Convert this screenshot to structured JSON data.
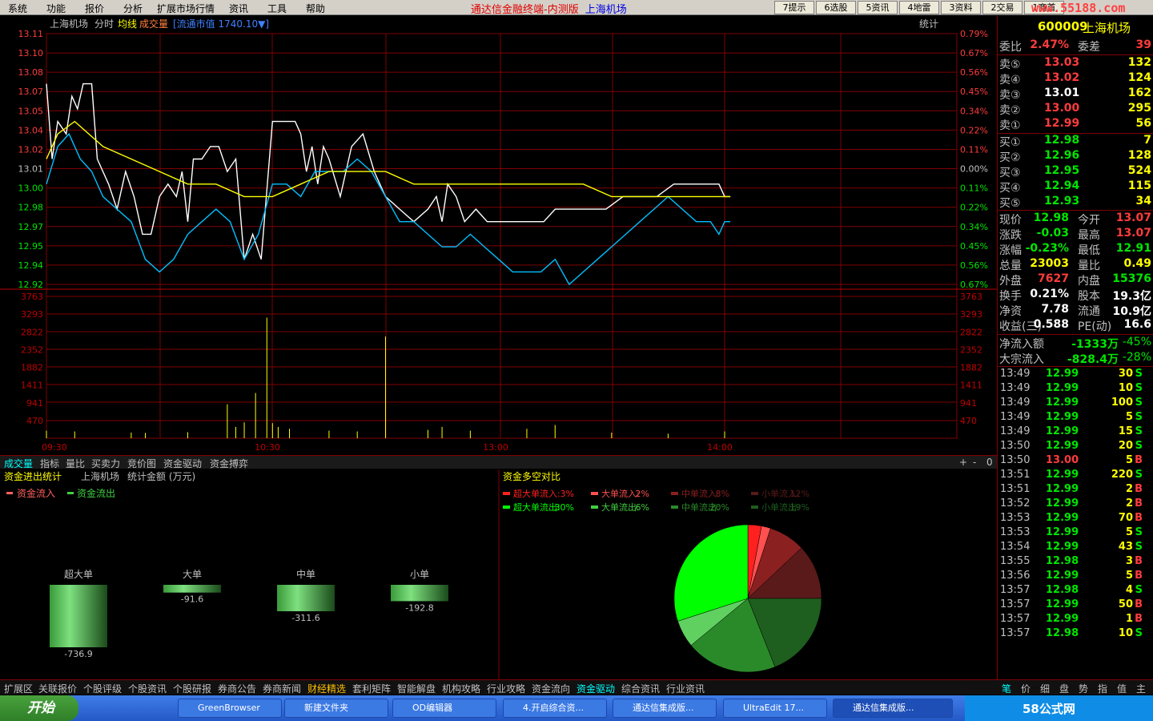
{
  "menu": [
    "系统",
    "功能",
    "报价",
    "分析",
    "扩展市场行情",
    "资讯",
    "工具",
    "帮助"
  ],
  "app_title": "通达信金融终端-内测版",
  "stock_title": "上海机场",
  "toolbar_buttons": [
    "7提示",
    "6选股",
    "5资讯",
    "4地雷",
    "3资料",
    "2交易",
    "1商首"
  ],
  "watermark": "www.55188.com",
  "chart_header": {
    "name": "上海机场",
    "mode": "分时",
    "avg": "均线",
    "vol": "成交量",
    "mktcap": "[流通市值 1740.10▼]",
    "stat": "统计"
  },
  "chart_data": {
    "type": "line",
    "price_axis": [
      "13.11",
      "13.10",
      "13.08",
      "13.07",
      "13.05",
      "13.04",
      "13.02",
      "13.01",
      "13.00",
      "12.98",
      "12.97",
      "12.95",
      "12.94",
      "12.92"
    ],
    "pct_axis": [
      "0.79%",
      "0.67%",
      "0.56%",
      "0.45%",
      "0.34%",
      "0.22%",
      "0.11%",
      "0.00%",
      "0.11%",
      "0.22%",
      "0.34%",
      "0.45%",
      "0.56%",
      "0.67%"
    ],
    "vol_axis": [
      "3763",
      "3293",
      "2822",
      "2352",
      "1882",
      "1411",
      "941",
      "470"
    ],
    "time_labels": [
      "09:30",
      "10:30",
      "13:00",
      "14:00"
    ],
    "ylim": [
      12.91,
      13.11
    ],
    "series": [
      {
        "color": "#ffffff",
        "x": [
          0,
          2,
          4,
          7,
          9,
          11,
          13,
          16,
          18,
          22,
          25,
          28,
          31,
          34,
          37,
          40,
          43,
          46,
          48,
          50,
          52,
          55,
          58,
          61,
          64,
          67,
          70,
          73,
          76,
          80,
          84,
          88,
          90,
          92,
          94,
          96,
          98,
          100,
          104,
          108,
          112,
          116,
          120,
          125,
          130,
          135,
          138,
          140,
          142,
          145,
          148,
          152,
          156,
          160,
          166,
          170,
          176,
          180,
          186,
          192,
          198,
          204,
          210,
          216,
          222,
          228,
          234,
          236,
          238,
          240,
          242
        ],
        "values": [
          13.07,
          13.01,
          13.04,
          13.03,
          13.06,
          13.05,
          13.07,
          13.07,
          13.01,
          12.99,
          12.97,
          13.0,
          12.98,
          12.95,
          12.95,
          12.98,
          12.99,
          12.98,
          13.0,
          12.96,
          13.01,
          13.01,
          13.02,
          13.02,
          13.0,
          13.01,
          12.93,
          12.95,
          12.93,
          13.04,
          13.04,
          13.04,
          13.03,
          13.0,
          13.02,
          12.99,
          13.02,
          13.01,
          12.98,
          13.02,
          13.03,
          13.0,
          12.98,
          12.97,
          12.96,
          12.97,
          12.98,
          12.96,
          12.99,
          12.98,
          12.96,
          12.97,
          12.96,
          12.96,
          12.96,
          12.96,
          12.96,
          12.97,
          12.97,
          12.97,
          12.97,
          12.98,
          12.98,
          12.98,
          12.99,
          12.99,
          12.99,
          12.99,
          12.99,
          12.98,
          12.98
        ]
      },
      {
        "color": "#00c0ff",
        "x": [
          0,
          4,
          8,
          12,
          16,
          20,
          25,
          30,
          35,
          40,
          45,
          50,
          55,
          60,
          65,
          70,
          75,
          80,
          85,
          90,
          95,
          100,
          105,
          110,
          115,
          120,
          125,
          130,
          135,
          140,
          145,
          150,
          155,
          160,
          165,
          170,
          175,
          180,
          185,
          190,
          195,
          200,
          205,
          210,
          215,
          220,
          225,
          230,
          235,
          238,
          240,
          242
        ],
        "values": [
          12.99,
          13.02,
          13.03,
          13.01,
          13.0,
          12.98,
          12.97,
          12.96,
          12.93,
          12.92,
          12.93,
          12.95,
          12.96,
          12.97,
          12.96,
          12.93,
          12.95,
          12.99,
          12.99,
          12.98,
          13.0,
          13.0,
          13.0,
          13.01,
          13.0,
          12.98,
          12.96,
          12.96,
          12.95,
          12.94,
          12.94,
          12.95,
          12.94,
          12.93,
          12.92,
          12.92,
          12.92,
          12.93,
          12.91,
          12.92,
          12.93,
          12.94,
          12.95,
          12.96,
          12.97,
          12.98,
          12.97,
          12.96,
          12.96,
          12.95,
          12.96,
          12.96
        ]
      },
      {
        "color": "#ffff00",
        "x": [
          0,
          4,
          10,
          20,
          30,
          40,
          50,
          60,
          70,
          80,
          90,
          100,
          110,
          120,
          130,
          140,
          150,
          160,
          170,
          180,
          190,
          200,
          210,
          220,
          230,
          240,
          242
        ],
        "values": [
          13.01,
          13.03,
          13.04,
          13.02,
          13.01,
          13.0,
          12.99,
          12.99,
          12.98,
          12.98,
          12.99,
          13.0,
          13.0,
          13.0,
          12.99,
          12.99,
          12.99,
          12.99,
          12.99,
          12.99,
          12.99,
          12.98,
          12.98,
          12.98,
          12.98,
          12.98,
          12.98
        ]
      }
    ],
    "volume_x": [
      0,
      10,
      30,
      35,
      50,
      64,
      67,
      70,
      74,
      78,
      80,
      82,
      86,
      100,
      110,
      120,
      135,
      140,
      150,
      170,
      180,
      200,
      220,
      240
    ],
    "volume": [
      200,
      180,
      150,
      140,
      160,
      900,
      300,
      420,
      1200,
      3200,
      400,
      300,
      250,
      200,
      180,
      2700,
      220,
      300,
      200,
      250,
      350,
      150,
      120,
      180
    ]
  },
  "quote": {
    "code": "600009",
    "name": "上海机场",
    "webi": "委比",
    "webi_val": "2.47%",
    "weicha": "委差",
    "weicha_val": "39",
    "asks": [
      {
        "l": "卖⑤",
        "p": "13.03",
        "v": "132"
      },
      {
        "l": "卖④",
        "p": "13.02",
        "v": "124"
      },
      {
        "l": "卖③",
        "p": "13.01",
        "v": "162"
      },
      {
        "l": "卖②",
        "p": "13.00",
        "v": "295"
      },
      {
        "l": "卖①",
        "p": "12.99",
        "v": "56"
      }
    ],
    "bids": [
      {
        "l": "买①",
        "p": "12.98",
        "v": "7"
      },
      {
        "l": "买②",
        "p": "12.96",
        "v": "128"
      },
      {
        "l": "买③",
        "p": "12.95",
        "v": "524"
      },
      {
        "l": "买④",
        "p": "12.94",
        "v": "115"
      },
      {
        "l": "买⑤",
        "p": "12.93",
        "v": "34"
      }
    ],
    "stats": [
      {
        "l": "现价",
        "v": "12.98",
        "l2": "今开",
        "v2": "13.07"
      },
      {
        "l": "涨跌",
        "v": "-0.03",
        "l2": "最高",
        "v2": "13.07"
      },
      {
        "l": "涨幅",
        "v": "-0.23%",
        "l2": "最低",
        "v2": "12.91"
      },
      {
        "l": "总量",
        "v": "23003",
        "l2": "量比",
        "v2": "0.49"
      },
      {
        "l": "外盘",
        "v": "7627",
        "l2": "内盘",
        "v2": "15376"
      },
      {
        "l": "换手",
        "v": "0.21%",
        "l2": "股本",
        "v2": "19.3亿"
      },
      {
        "l": "净资",
        "v": "7.78",
        "l2": "流通",
        "v2": "10.9亿"
      },
      {
        "l": "收益(三)",
        "v": "0.588",
        "l2": "PE(动)",
        "v2": "16.6"
      }
    ],
    "flow": [
      {
        "l": "净流入额",
        "v": "-1333万",
        "v2": "-45%"
      },
      {
        "l": "大宗流入",
        "v": "-828.4万",
        "v2": "-28%"
      }
    ]
  },
  "ticks": [
    {
      "t": "13:49",
      "p": "12.99",
      "q": "30",
      "s": "S"
    },
    {
      "t": "13:49",
      "p": "12.99",
      "q": "10",
      "s": "S"
    },
    {
      "t": "13:49",
      "p": "12.99",
      "q": "100",
      "s": "S"
    },
    {
      "t": "13:49",
      "p": "12.99",
      "q": "5",
      "s": "S"
    },
    {
      "t": "13:49",
      "p": "12.99",
      "q": "15",
      "s": "S"
    },
    {
      "t": "13:50",
      "p": "12.99",
      "q": "20",
      "s": "S"
    },
    {
      "t": "13:50",
      "p": "13.00",
      "q": "5",
      "s": "B"
    },
    {
      "t": "13:51",
      "p": "12.99",
      "q": "220",
      "s": "S"
    },
    {
      "t": "13:51",
      "p": "12.99",
      "q": "2",
      "s": "B"
    },
    {
      "t": "13:52",
      "p": "12.99",
      "q": "2",
      "s": "B"
    },
    {
      "t": "13:53",
      "p": "12.99",
      "q": "70",
      "s": "B"
    },
    {
      "t": "13:53",
      "p": "12.99",
      "q": "5",
      "s": "S"
    },
    {
      "t": "13:54",
      "p": "12.99",
      "q": "43",
      "s": "S"
    },
    {
      "t": "13:55",
      "p": "12.98",
      "q": "3",
      "s": "B"
    },
    {
      "t": "13:56",
      "p": "12.99",
      "q": "5",
      "s": "B"
    },
    {
      "t": "13:57",
      "p": "12.98",
      "q": "4",
      "s": "S"
    },
    {
      "t": "13:57",
      "p": "12.99",
      "q": "50",
      "s": "B"
    },
    {
      "t": "13:57",
      "p": "12.99",
      "q": "1",
      "s": "B"
    },
    {
      "t": "13:57",
      "p": "12.98",
      "q": "10",
      "s": "S"
    }
  ],
  "indicator_tabs": [
    "成交量",
    "指标",
    "量比",
    "买卖力",
    "竞价图",
    "资金驱动",
    "资金搏弈"
  ],
  "fund_panel": {
    "title": "资金进出统计",
    "name": "上海机场",
    "unit": "统计金额 (万元)",
    "legend_in": "资金流入",
    "legend_out": "资金流出",
    "bars": [
      {
        "label": "超大单",
        "value": -736.9
      },
      {
        "label": "大单",
        "value": -91.6
      },
      {
        "label": "中单",
        "value": -311.6
      },
      {
        "label": "小单",
        "value": -192.8
      }
    ]
  },
  "pie_panel": {
    "title": "资金多空对比",
    "legend": [
      {
        "label": "超大单流入:",
        "pct": "3%",
        "color": "#ff2020"
      },
      {
        "label": "大单流入:",
        "pct": "2%",
        "color": "#ff5050"
      },
      {
        "label": "中单流入:",
        "pct": "8%",
        "color": "#8b2020"
      },
      {
        "label": "小单流入:",
        "pct": "12%",
        "color": "#5a1a1a"
      },
      {
        "label": "超大单流出:",
        "pct": "30%",
        "color": "#00ff00"
      },
      {
        "label": "大单流出:",
        "pct": "6%",
        "color": "#40d040"
      },
      {
        "label": "中单流出:",
        "pct": "20%",
        "color": "#2a8a2a"
      },
      {
        "label": "小单流出:",
        "pct": "19%",
        "color": "#1e5e1e"
      }
    ],
    "slices": [
      3,
      2,
      8,
      12,
      19,
      20,
      6,
      30
    ]
  },
  "bottom_tabs": [
    "扩展区",
    "关联报价",
    "个股评级",
    "个股资讯",
    "个股研报",
    "券商公告",
    "券商新闻",
    "财经精选",
    "套利矩阵",
    "智能解盘",
    "机构攻略",
    "行业攻略",
    "资金流向",
    "资金驱动",
    "综合资讯",
    "行业资讯"
  ],
  "right_tabs": [
    "笔",
    "价",
    "细",
    "盘",
    "势",
    "指",
    "值",
    "主"
  ],
  "taskbar": {
    "start": "开始",
    "tasks": [
      "GreenBrowser",
      "新建文件夹",
      "OD编辑器",
      "4.开启综合资...",
      "通达信集成版...",
      "UltraEdit 17...",
      "通达信集成版..."
    ],
    "tray": "58公式网"
  }
}
